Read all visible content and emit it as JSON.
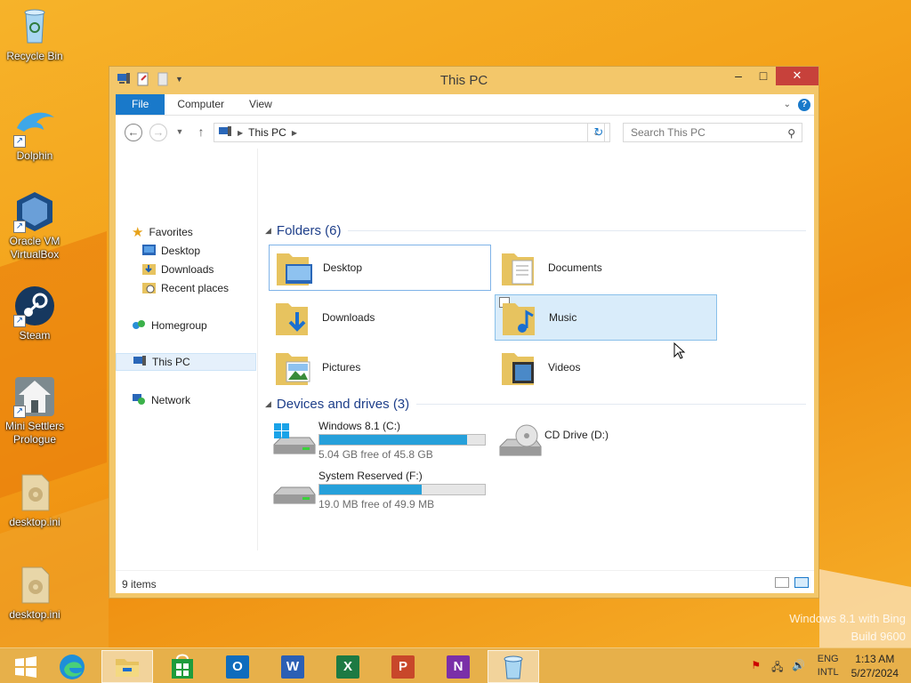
{
  "desktop": {
    "icons": [
      {
        "label": "Recycle Bin",
        "icon": "recycle-bin-icon"
      },
      {
        "label": "Dolphin",
        "icon": "dolphin-icon"
      },
      {
        "label": "Oracle VM VirtualBox",
        "icon": "virtualbox-icon"
      },
      {
        "label": "Steam",
        "icon": "steam-icon"
      },
      {
        "label": "Mini Settlers Prologue",
        "icon": "mini-settlers-icon"
      },
      {
        "label": "desktop.ini",
        "icon": "ini-file-icon"
      },
      {
        "label": "desktop.ini",
        "icon": "ini-file-icon"
      }
    ],
    "watermark": {
      "line1": "Windows 8.1 with Bing",
      "line2": "Build 9600"
    }
  },
  "window": {
    "title": "This PC",
    "controls": {
      "minimize": "–",
      "maximize": "□",
      "close": "✕"
    },
    "ribbon": {
      "tabs": [
        "File",
        "Computer",
        "View"
      ]
    },
    "address": {
      "breadcrumb": "This PC",
      "search_placeholder": "Search This PC"
    },
    "nav_pane": {
      "favorites": "Favorites",
      "favorite_items": [
        "Desktop",
        "Downloads",
        "Recent places"
      ],
      "homegroup": "Homegroup",
      "this_pc": "This PC",
      "network": "Network"
    },
    "folders_group": {
      "title": "Folders (6)",
      "items": [
        "Desktop",
        "Documents",
        "Downloads",
        "Music",
        "Pictures",
        "Videos"
      ]
    },
    "drives_group": {
      "title": "Devices and drives (3)",
      "drives": [
        {
          "name": "Windows 8.1 (C:)",
          "free": "5.04 GB free of 45.8 GB",
          "used_fraction": 0.89
        },
        {
          "name": "System Reserved (F:)",
          "free": "19.0 MB free of 49.9 MB",
          "used_fraction": 0.62
        },
        {
          "name": "CD Drive (D:)"
        }
      ]
    },
    "status": {
      "items": "9 items"
    }
  },
  "taskbar": {
    "apps": [
      "start",
      "edge",
      "file-explorer",
      "store",
      "outlook",
      "word",
      "excel",
      "powerpoint",
      "onenote",
      "recycle-bin"
    ],
    "tile_letters": {
      "outlook": "O",
      "word": "W",
      "excel": "X",
      "powerpoint": "P",
      "onenote": "N"
    },
    "language": {
      "line1": "ENG",
      "line2": "INTL"
    },
    "clock": {
      "time": "1:13 AM",
      "date": "5/27/2024"
    }
  },
  "colors": {
    "accent": "#1979ca",
    "titlebar": "#f3c76a",
    "close": "#c7413b",
    "progress": "#26a0da",
    "group_title": "#1e3f8a"
  }
}
